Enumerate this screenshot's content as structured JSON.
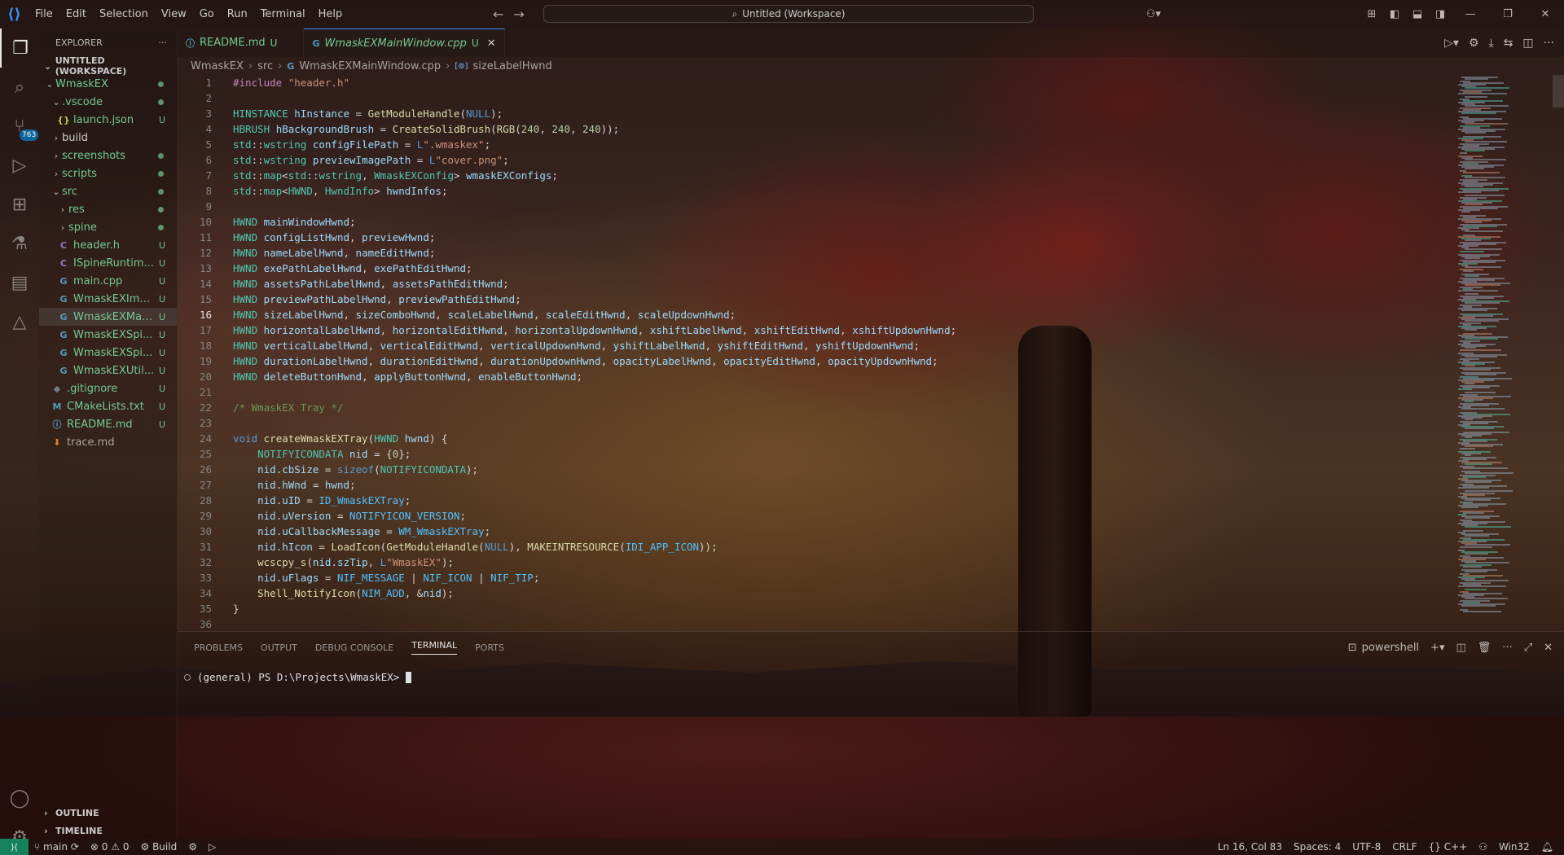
{
  "titlebar": {
    "menu": [
      "File",
      "Edit",
      "Selection",
      "View",
      "Go",
      "Run",
      "Terminal",
      "Help"
    ],
    "search": "Untitled (Workspace)"
  },
  "activity": {
    "scm_badge": "763"
  },
  "explorer": {
    "title": "EXPLORER",
    "more": "···",
    "workspace": "UNTITLED (WORKSPACE)",
    "items": [
      {
        "label": "WmaskEX",
        "indent": 1,
        "type": "folder-open",
        "mark": "dot"
      },
      {
        "label": ".vscode",
        "indent": 2,
        "type": "folder-open",
        "mark": "dot"
      },
      {
        "label": "launch.json",
        "indent": 3,
        "type": "json",
        "icon": "{}",
        "mark": "U"
      },
      {
        "label": "build",
        "indent": 2,
        "type": "folder",
        "mark": ""
      },
      {
        "label": "screenshots",
        "indent": 2,
        "type": "folder",
        "mark": "dot"
      },
      {
        "label": "scripts",
        "indent": 2,
        "type": "folder",
        "mark": "dot"
      },
      {
        "label": "src",
        "indent": 2,
        "type": "folder-open",
        "mark": "dot"
      },
      {
        "label": "res",
        "indent": 3,
        "type": "folder",
        "mark": "dot"
      },
      {
        "label": "spine",
        "indent": 3,
        "type": "folder",
        "mark": "dot"
      },
      {
        "label": "header.h",
        "indent": 3,
        "type": "file",
        "icon": "C",
        "mark": "U"
      },
      {
        "label": "ISpineRuntim...",
        "indent": 3,
        "type": "file",
        "icon": "C",
        "mark": "U"
      },
      {
        "label": "main.cpp",
        "indent": 3,
        "type": "file",
        "icon": "G",
        "mark": "U"
      },
      {
        "label": "WmaskEXIma...",
        "indent": 3,
        "type": "file",
        "icon": "G",
        "mark": "U"
      },
      {
        "label": "WmaskEXMai...",
        "indent": 3,
        "type": "file",
        "icon": "G",
        "mark": "U",
        "selected": true
      },
      {
        "label": "WmaskEXSpi...",
        "indent": 3,
        "type": "file",
        "icon": "G",
        "mark": "U"
      },
      {
        "label": "WmaskEXSpi...",
        "indent": 3,
        "type": "file",
        "icon": "G",
        "mark": "U"
      },
      {
        "label": "WmaskEXUtil...",
        "indent": 3,
        "type": "file",
        "icon": "G",
        "mark": "U"
      },
      {
        "label": ".gitignore",
        "indent": 2,
        "type": "file",
        "icon": "◆",
        "mark": "U"
      },
      {
        "label": "CMakeLists.txt",
        "indent": 2,
        "type": "file",
        "icon": "M",
        "mark": "U"
      },
      {
        "label": "README.md",
        "indent": 2,
        "type": "file",
        "icon": "ⓘ",
        "mark": "U"
      },
      {
        "label": "trace.md",
        "indent": 2,
        "type": "file",
        "icon": "⬇",
        "mark": ""
      }
    ],
    "outline": "OUTLINE",
    "timeline": "TIMELINE"
  },
  "tabs": [
    {
      "name": "README.md",
      "status": "U",
      "icon": "ⓘ",
      "active": false
    },
    {
      "name": "WmaskEXMainWindow.cpp",
      "status": "U",
      "icon": "G",
      "active": true
    }
  ],
  "breadcrumbs": [
    "WmaskEX",
    "src",
    "WmaskEXMainWindow.cpp",
    "sizeLabelHwnd"
  ],
  "editor": {
    "current_line": 16,
    "lines": [
      [
        [
          "pp",
          "#include "
        ],
        [
          "str",
          "\"header.h\""
        ]
      ],
      [],
      [
        [
          "type",
          "HINSTANCE"
        ],
        [
          "op",
          " "
        ],
        [
          "var",
          "hInstance"
        ],
        [
          "op",
          " = "
        ],
        [
          "fn",
          "GetModuleHandle"
        ],
        [
          "op",
          "("
        ],
        [
          "kw",
          "NULL"
        ],
        [
          "op",
          ");"
        ]
      ],
      [
        [
          "type",
          "HBRUSH"
        ],
        [
          "op",
          " "
        ],
        [
          "var",
          "hBackgroundBrush"
        ],
        [
          "op",
          " = "
        ],
        [
          "fn",
          "CreateSolidBrush"
        ],
        [
          "op",
          "("
        ],
        [
          "fn",
          "RGB"
        ],
        [
          "op",
          "("
        ],
        [
          "num",
          "240"
        ],
        [
          "op",
          ", "
        ],
        [
          "num",
          "240"
        ],
        [
          "op",
          ", "
        ],
        [
          "num",
          "240"
        ],
        [
          "op",
          "));"
        ]
      ],
      [
        [
          "type",
          "std"
        ],
        [
          "op",
          "::"
        ],
        [
          "type",
          "wstring"
        ],
        [
          "op",
          " "
        ],
        [
          "var",
          "configFilePath"
        ],
        [
          "op",
          " = "
        ],
        [
          "kw",
          "L"
        ],
        [
          "str",
          "\".wmaskex\""
        ],
        [
          "op",
          ";"
        ]
      ],
      [
        [
          "type",
          "std"
        ],
        [
          "op",
          "::"
        ],
        [
          "type",
          "wstring"
        ],
        [
          "op",
          " "
        ],
        [
          "var",
          "previewImagePath"
        ],
        [
          "op",
          " = "
        ],
        [
          "kw",
          "L"
        ],
        [
          "str",
          "\"cover.png\""
        ],
        [
          "op",
          ";"
        ]
      ],
      [
        [
          "type",
          "std"
        ],
        [
          "op",
          "::"
        ],
        [
          "type",
          "map"
        ],
        [
          "op",
          "<"
        ],
        [
          "type",
          "std"
        ],
        [
          "op",
          "::"
        ],
        [
          "type",
          "wstring"
        ],
        [
          "op",
          ", "
        ],
        [
          "type",
          "WmaskEXConfig"
        ],
        [
          "op",
          "> "
        ],
        [
          "var",
          "wmaskEXConfigs"
        ],
        [
          "op",
          ";"
        ]
      ],
      [
        [
          "type",
          "std"
        ],
        [
          "op",
          "::"
        ],
        [
          "type",
          "map"
        ],
        [
          "op",
          "<"
        ],
        [
          "type",
          "HWND"
        ],
        [
          "op",
          ", "
        ],
        [
          "type",
          "HwndInfo"
        ],
        [
          "op",
          "> "
        ],
        [
          "var",
          "hwndInfos"
        ],
        [
          "op",
          ";"
        ]
      ],
      [],
      [
        [
          "type",
          "HWND"
        ],
        [
          "op",
          " "
        ],
        [
          "var",
          "mainWindowHwnd"
        ],
        [
          "op",
          ";"
        ]
      ],
      [
        [
          "type",
          "HWND"
        ],
        [
          "op",
          " "
        ],
        [
          "var",
          "configListHwnd"
        ],
        [
          "op",
          ", "
        ],
        [
          "var",
          "previewHwnd"
        ],
        [
          "op",
          ";"
        ]
      ],
      [
        [
          "type",
          "HWND"
        ],
        [
          "op",
          " "
        ],
        [
          "var",
          "nameLabelHwnd"
        ],
        [
          "op",
          ", "
        ],
        [
          "var",
          "nameEditHwnd"
        ],
        [
          "op",
          ";"
        ]
      ],
      [
        [
          "type",
          "HWND"
        ],
        [
          "op",
          " "
        ],
        [
          "var",
          "exePathLabelHwnd"
        ],
        [
          "op",
          ", "
        ],
        [
          "var",
          "exePathEditHwnd"
        ],
        [
          "op",
          ";"
        ]
      ],
      [
        [
          "type",
          "HWND"
        ],
        [
          "op",
          " "
        ],
        [
          "var",
          "assetsPathLabelHwnd"
        ],
        [
          "op",
          ", "
        ],
        [
          "var",
          "assetsPathEditHwnd"
        ],
        [
          "op",
          ";"
        ]
      ],
      [
        [
          "type",
          "HWND"
        ],
        [
          "op",
          " "
        ],
        [
          "var",
          "previewPathLabelHwnd"
        ],
        [
          "op",
          ", "
        ],
        [
          "var",
          "previewPathEditHwnd"
        ],
        [
          "op",
          ";"
        ]
      ],
      [
        [
          "type",
          "HWND"
        ],
        [
          "op",
          " "
        ],
        [
          "var",
          "sizeLabelHwnd"
        ],
        [
          "op",
          ", "
        ],
        [
          "var",
          "sizeComboHwnd"
        ],
        [
          "op",
          ", "
        ],
        [
          "var",
          "scaleLabelHwnd"
        ],
        [
          "op",
          ", "
        ],
        [
          "var",
          "scaleEditHwnd"
        ],
        [
          "op",
          ", "
        ],
        [
          "var",
          "scaleUpdownHwnd"
        ],
        [
          "op",
          ";"
        ]
      ],
      [
        [
          "type",
          "HWND"
        ],
        [
          "op",
          " "
        ],
        [
          "var",
          "horizontalLabelHwnd"
        ],
        [
          "op",
          ", "
        ],
        [
          "var",
          "horizontalEditHwnd"
        ],
        [
          "op",
          ", "
        ],
        [
          "var",
          "horizontalUpdownHwnd"
        ],
        [
          "op",
          ", "
        ],
        [
          "var",
          "xshiftLabelHwnd"
        ],
        [
          "op",
          ", "
        ],
        [
          "var",
          "xshiftEditHwnd"
        ],
        [
          "op",
          ", "
        ],
        [
          "var",
          "xshiftUpdownHwnd"
        ],
        [
          "op",
          ";"
        ]
      ],
      [
        [
          "type",
          "HWND"
        ],
        [
          "op",
          " "
        ],
        [
          "var",
          "verticalLabelHwnd"
        ],
        [
          "op",
          ", "
        ],
        [
          "var",
          "verticalEditHwnd"
        ],
        [
          "op",
          ", "
        ],
        [
          "var",
          "verticalUpdownHwnd"
        ],
        [
          "op",
          ", "
        ],
        [
          "var",
          "yshiftLabelHwnd"
        ],
        [
          "op",
          ", "
        ],
        [
          "var",
          "yshiftEditHwnd"
        ],
        [
          "op",
          ", "
        ],
        [
          "var",
          "yshiftUpdownHwnd"
        ],
        [
          "op",
          ";"
        ]
      ],
      [
        [
          "type",
          "HWND"
        ],
        [
          "op",
          " "
        ],
        [
          "var",
          "durationLabelHwnd"
        ],
        [
          "op",
          ", "
        ],
        [
          "var",
          "durationEditHwnd"
        ],
        [
          "op",
          ", "
        ],
        [
          "var",
          "durationUpdownHwnd"
        ],
        [
          "op",
          ", "
        ],
        [
          "var",
          "opacityLabelHwnd"
        ],
        [
          "op",
          ", "
        ],
        [
          "var",
          "opacityEditHwnd"
        ],
        [
          "op",
          ", "
        ],
        [
          "var",
          "opacityUpdownHwnd"
        ],
        [
          "op",
          ";"
        ]
      ],
      [
        [
          "type",
          "HWND"
        ],
        [
          "op",
          " "
        ],
        [
          "var",
          "deleteButtonHwnd"
        ],
        [
          "op",
          ", "
        ],
        [
          "var",
          "applyButtonHwnd"
        ],
        [
          "op",
          ", "
        ],
        [
          "var",
          "enableButtonHwnd"
        ],
        [
          "op",
          ";"
        ]
      ],
      [],
      [
        [
          "cm",
          "/* WmaskEX Tray */"
        ]
      ],
      [],
      [
        [
          "kw",
          "void"
        ],
        [
          "op",
          " "
        ],
        [
          "fn",
          "createWmaskEXTray"
        ],
        [
          "op",
          "("
        ],
        [
          "type",
          "HWND"
        ],
        [
          "op",
          " "
        ],
        [
          "var",
          "hwnd"
        ],
        [
          "op",
          ") {"
        ]
      ],
      [
        [
          "op",
          "    "
        ],
        [
          "type",
          "NOTIFYICONDATA"
        ],
        [
          "op",
          " "
        ],
        [
          "var",
          "nid"
        ],
        [
          "op",
          " = {"
        ],
        [
          "num",
          "0"
        ],
        [
          "op",
          "};"
        ]
      ],
      [
        [
          "op",
          "    "
        ],
        [
          "var",
          "nid"
        ],
        [
          "op",
          "."
        ],
        [
          "var",
          "cbSize"
        ],
        [
          "op",
          " = "
        ],
        [
          "kw",
          "sizeof"
        ],
        [
          "op",
          "("
        ],
        [
          "type",
          "NOTIFYICONDATA"
        ],
        [
          "op",
          ");"
        ]
      ],
      [
        [
          "op",
          "    "
        ],
        [
          "var",
          "nid"
        ],
        [
          "op",
          "."
        ],
        [
          "var",
          "hWnd"
        ],
        [
          "op",
          " = "
        ],
        [
          "var",
          "hwnd"
        ],
        [
          "op",
          ";"
        ]
      ],
      [
        [
          "op",
          "    "
        ],
        [
          "var",
          "nid"
        ],
        [
          "op",
          "."
        ],
        [
          "var",
          "uID"
        ],
        [
          "op",
          " = "
        ],
        [
          "mac",
          "ID_WmaskEXTray"
        ],
        [
          "op",
          ";"
        ]
      ],
      [
        [
          "op",
          "    "
        ],
        [
          "var",
          "nid"
        ],
        [
          "op",
          "."
        ],
        [
          "var",
          "uVersion"
        ],
        [
          "op",
          " = "
        ],
        [
          "mac",
          "NOTIFYICON_VERSION"
        ],
        [
          "op",
          ";"
        ]
      ],
      [
        [
          "op",
          "    "
        ],
        [
          "var",
          "nid"
        ],
        [
          "op",
          "."
        ],
        [
          "var",
          "uCallbackMessage"
        ],
        [
          "op",
          " = "
        ],
        [
          "mac",
          "WM_WmaskEXTray"
        ],
        [
          "op",
          ";"
        ]
      ],
      [
        [
          "op",
          "    "
        ],
        [
          "var",
          "nid"
        ],
        [
          "op",
          "."
        ],
        [
          "var",
          "hIcon"
        ],
        [
          "op",
          " = "
        ],
        [
          "fn",
          "LoadIcon"
        ],
        [
          "op",
          "("
        ],
        [
          "fn",
          "GetModuleHandle"
        ],
        [
          "op",
          "("
        ],
        [
          "kw",
          "NULL"
        ],
        [
          "op",
          "), "
        ],
        [
          "fn",
          "MAKEINTRESOURCE"
        ],
        [
          "op",
          "("
        ],
        [
          "mac",
          "IDI_APP_ICON"
        ],
        [
          "op",
          "));"
        ]
      ],
      [
        [
          "op",
          "    "
        ],
        [
          "fn",
          "wcscpy_s"
        ],
        [
          "op",
          "("
        ],
        [
          "var",
          "nid"
        ],
        [
          "op",
          "."
        ],
        [
          "var",
          "szTip"
        ],
        [
          "op",
          ", "
        ],
        [
          "kw",
          "L"
        ],
        [
          "str",
          "\"WmaskEX\""
        ],
        [
          "op",
          ");"
        ]
      ],
      [
        [
          "op",
          "    "
        ],
        [
          "var",
          "nid"
        ],
        [
          "op",
          "."
        ],
        [
          "var",
          "uFlags"
        ],
        [
          "op",
          " = "
        ],
        [
          "mac",
          "NIF_MESSAGE"
        ],
        [
          "op",
          " | "
        ],
        [
          "mac",
          "NIF_ICON"
        ],
        [
          "op",
          " | "
        ],
        [
          "mac",
          "NIF_TIP"
        ],
        [
          "op",
          ";"
        ]
      ],
      [
        [
          "op",
          "    "
        ],
        [
          "fn",
          "Shell_NotifyIcon"
        ],
        [
          "op",
          "("
        ],
        [
          "mac",
          "NIM_ADD"
        ],
        [
          "op",
          ", &"
        ],
        [
          "var",
          "nid"
        ],
        [
          "op",
          ");"
        ]
      ],
      [
        [
          "op",
          "}"
        ]
      ],
      []
    ]
  },
  "panel": {
    "tabs": [
      "PROBLEMS",
      "OUTPUT",
      "DEBUG CONSOLE",
      "TERMINAL",
      "PORTS"
    ],
    "active_tab": "TERMINAL",
    "shell": "powershell",
    "prompt": "(general) PS D:\\Projects\\WmaskEX>"
  },
  "statusbar": {
    "branch": "main",
    "errors": "0",
    "warnings": "0",
    "build": "Build",
    "position": "Ln 16, Col 83",
    "spaces": "Spaces: 4",
    "encoding": "UTF-8",
    "eol": "CRLF",
    "language": "C++",
    "platform": "Win32"
  },
  "colors": {
    "accent": "#3794ff",
    "git_untracked": "#73c991",
    "remote": "#16825d"
  }
}
